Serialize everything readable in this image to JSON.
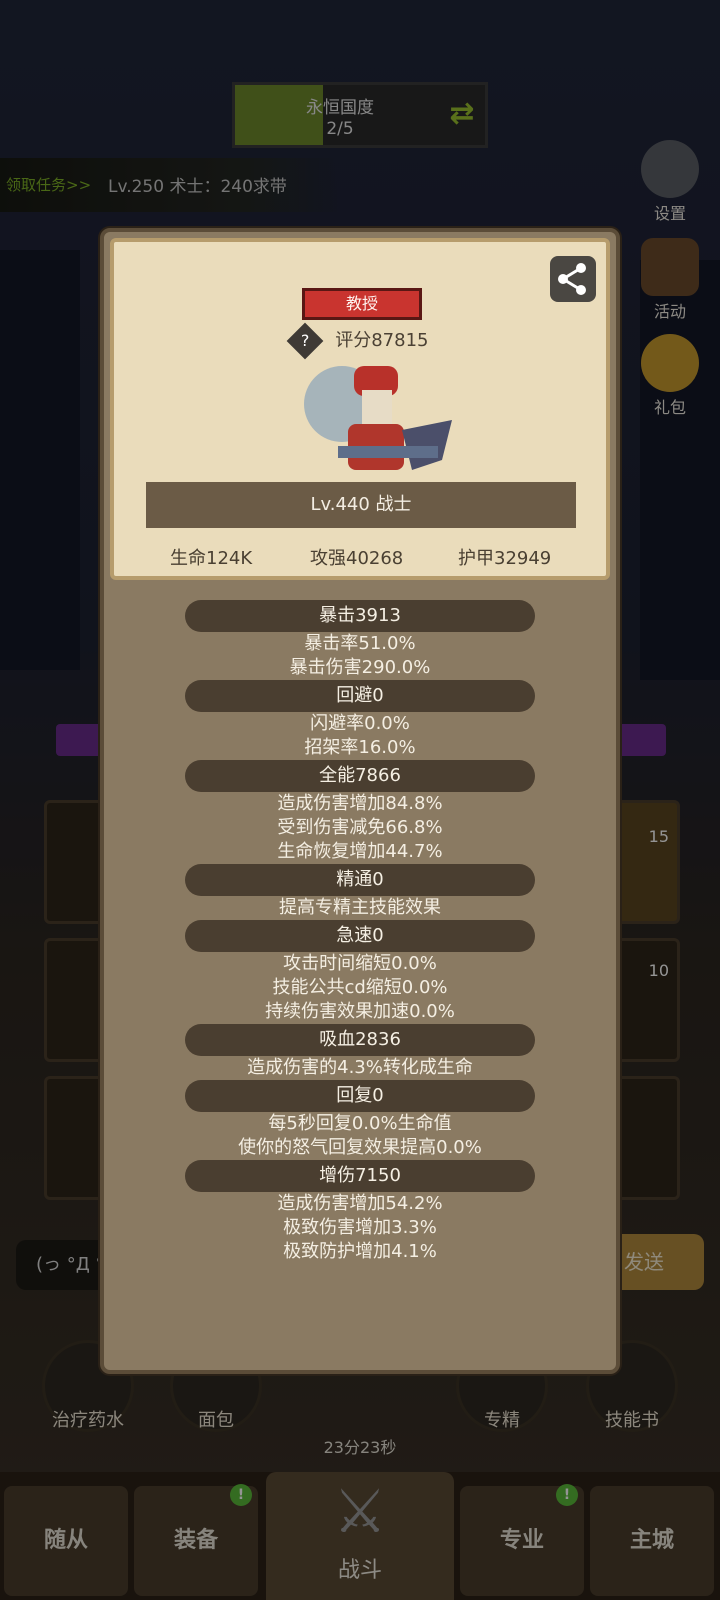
{
  "quest": {
    "title": "永恒国度",
    "progress": "2/5",
    "progress_fraction": 0.35
  },
  "task": {
    "link": "领取任务>>",
    "text": "Lv.250 术士：240求带"
  },
  "side_menu": [
    {
      "label": "设置",
      "icon": "gear-icon"
    },
    {
      "label": "活动",
      "icon": "scroll-icon"
    },
    {
      "label": "礼包",
      "icon": "gift-coin-icon"
    }
  ],
  "chat": {
    "input_text": "(っ °Д °;)",
    "send_label": "发送"
  },
  "consumables": [
    {
      "label": "治疗药水",
      "icon": "potion-icon"
    },
    {
      "label": "面包",
      "icon": "bread-icon"
    },
    {
      "label": "专精",
      "icon": "target-icon"
    },
    {
      "label": "技能书",
      "icon": "book-icon"
    }
  ],
  "timer": "23分23秒",
  "nav": {
    "items": [
      {
        "label": "随从",
        "badge": ""
      },
      {
        "label": "装备",
        "badge": "!"
      },
      {
        "label": "战斗",
        "badge": ""
      },
      {
        "label": "专业",
        "badge": "!"
      },
      {
        "label": "主城",
        "badge": ""
      }
    ]
  },
  "slot_badges": [
    "15",
    "10"
  ],
  "profile": {
    "title_badge": "教授",
    "rating": "评分87815",
    "level_class": "Lv.440 战士",
    "stats": [
      "生命124K",
      "攻强40268",
      "护甲32949"
    ]
  },
  "attributes": [
    {
      "header": "暴击3913",
      "lines": [
        "暴击率51.0%",
        "暴击伤害290.0%"
      ]
    },
    {
      "header": "回避0",
      "lines": [
        "闪避率0.0%",
        "招架率16.0%"
      ]
    },
    {
      "header": "全能7866",
      "lines": [
        "造成伤害增加84.8%",
        "受到伤害减免66.8%",
        "生命恢复增加44.7%"
      ]
    },
    {
      "header": "精通0",
      "lines": [
        "提高专精主技能效果"
      ]
    },
    {
      "header": "急速0",
      "lines": [
        "攻击时间缩短0.0%",
        "技能公共cd缩短0.0%",
        "持续伤害效果加速0.0%"
      ]
    },
    {
      "header": "吸血2836",
      "lines": [
        "造成伤害的4.3%转化成生命"
      ]
    },
    {
      "header": "回复0",
      "lines": [
        "每5秒回复0.0%生命值",
        "使你的怒气回复效果提高0.0%"
      ]
    },
    {
      "header": "增伤7150",
      "lines": [
        "造成伤害增加54.2%",
        "极致伤害增加3.3%",
        "极致防护增加4.1%"
      ]
    }
  ]
}
